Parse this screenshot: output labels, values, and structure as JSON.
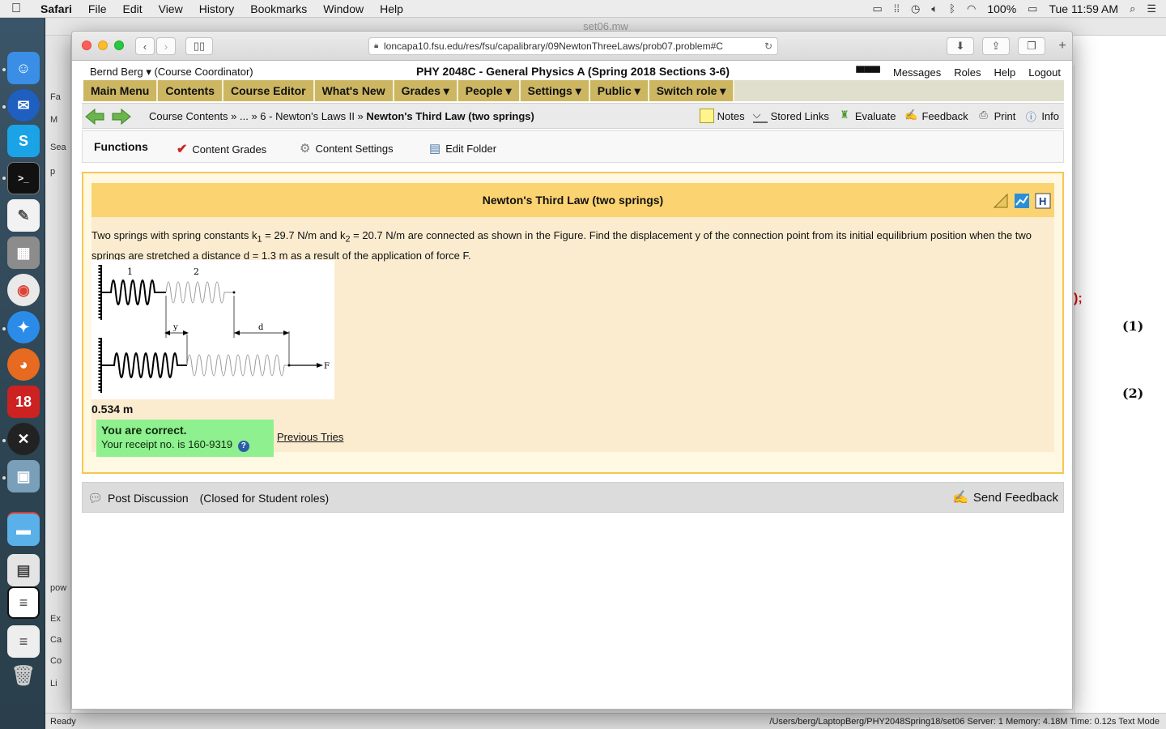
{
  "menubar": {
    "app": "Safari",
    "items": [
      "File",
      "Edit",
      "View",
      "History",
      "Bookmarks",
      "Window",
      "Help"
    ],
    "battery": "100%",
    "clock": "Tue 11:59 AM"
  },
  "background_window": {
    "title": "set06.mw",
    "side_labels": [
      "Fa",
      "M",
      "Sea",
      "p",
      "pow",
      "Ex",
      "Ca",
      "Co",
      "Li"
    ],
    "red_text": ");",
    "eq1": "(1)",
    "eq2": "(2)",
    "status_left": "Ready",
    "status_right": "/Users/berg/LaptopBerg/PHY2048Spring18/set06   Server: 1   Memory: 4.18M   Time: 0.12s   Text Mode"
  },
  "browser": {
    "url": "loncapa10.fsu.edu/res/fsu/capalibrary/09NewtonThreeLaws/prob07.problem#C"
  },
  "header": {
    "user": "Bernd Berg ▾",
    "role": "(Course Coordinator)",
    "course": "PHY 2048C - General Physics A (Spring 2018 Sections 3-6)",
    "links": [
      "Messages",
      "Roles",
      "Help",
      "Logout"
    ]
  },
  "mainnav": [
    "Main Menu",
    "Contents",
    "Course Editor",
    "What's New",
    "Grades ▾",
    "People ▾",
    "Settings ▾",
    "Public ▾",
    "Switch role ▾"
  ],
  "crumbs": {
    "path": "Course Contents » ... » 6 - Newton's Laws II » ",
    "current": "Newton's Third Law (two springs)",
    "tools": [
      "Notes",
      "Stored Links",
      "Evaluate",
      "Feedback",
      "Print",
      "Info"
    ]
  },
  "functions": {
    "title": "Functions",
    "items": [
      "Content Grades",
      "Content Settings",
      "Edit Folder"
    ]
  },
  "problem": {
    "title": "Newton's Third Law (two springs)",
    "text_1": "Two springs with spring constants k",
    "sub_1": "1",
    "text_2": " = 29.7 N/m and k",
    "sub_2": "2",
    "text_3": " = 20.7 N/m are connected as shown in the Figure. Find the displacement y of the connection point from its initial equilibrium position when the two springs are stretched a distance d = 1.3 m as a result of the application of force F.",
    "figure_labels": {
      "spring1": "1",
      "spring2": "2",
      "y": "y",
      "d": "d",
      "F": "F"
    },
    "answer": "0.534 m",
    "correct_title": "You are correct.",
    "receipt": "Your receipt no. is 160-9319",
    "previous_tries": "Previous Tries"
  },
  "discussion": {
    "post": "Post Discussion",
    "closed": "(Closed for Student roles)",
    "feedback": "Send Feedback"
  }
}
